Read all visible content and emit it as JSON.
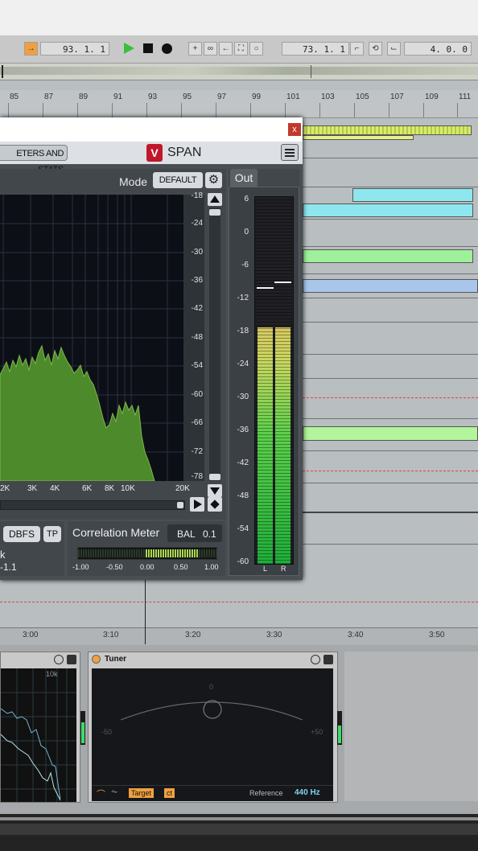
{
  "transport": {
    "position": "93. 1. 1",
    "loop_start": "73. 1. 1",
    "loop_length": "4. 0. 0"
  },
  "ruler": {
    "bars": [
      "85",
      "87",
      "89",
      "91",
      "93",
      "95",
      "97",
      "99",
      "101",
      "103",
      "105",
      "107",
      "109",
      "111"
    ]
  },
  "timeline": {
    "labels": [
      "3:00",
      "3:10",
      "3:20",
      "3:30",
      "3:40",
      "3:50"
    ]
  },
  "span": {
    "close_label": "x",
    "meters_tab": "ETERS AND STATS",
    "logo": "V",
    "title": "SPAN",
    "mode_label": "Mode",
    "mode_value": "DEFAULT",
    "db_scale": [
      "-18",
      "-24",
      "-30",
      "-36",
      "-42",
      "-48",
      "-54",
      "-60",
      "-66",
      "-72",
      "-78"
    ],
    "freq_labels": [
      "2K",
      "3K",
      "4K",
      "6K",
      "8K",
      "10K",
      "20K"
    ],
    "out_label": "Out",
    "out_scale": [
      "6",
      "0",
      "-6",
      "-12",
      "-18",
      "-24",
      "-30",
      "-36",
      "-42",
      "-48",
      "-54",
      "-60"
    ],
    "channels": [
      "L",
      "R"
    ],
    "left_peak": 0.755,
    "right_peak": 0.77,
    "level_fill": 0.645,
    "dbfs_label": "DBFS",
    "tp_label": "TP",
    "stat_label": "k",
    "stat_value": "-1.1",
    "corr_label": "Correlation Meter",
    "bal_label": "BAL",
    "bal_value": "0.1",
    "corr_scale": [
      "-1.00",
      "-0.50",
      "0.00",
      "0.50",
      "1.00"
    ]
  },
  "dev1": {
    "freq_label": "10k"
  },
  "tuner": {
    "title": "Tuner",
    "center": "0",
    "left_mark": "-50",
    "right_mark": "+50",
    "target_label": "Target",
    "ct_label": "ct",
    "reference_label": "Reference",
    "reference_value": "440 Hz"
  },
  "colors": {
    "accent_orange": "#f0a040",
    "clip_cyan": "#8ee7ee",
    "clip_green": "#9ef09a",
    "clip_blue": "#a9c6ea",
    "spectrum_green": "#4c8a2c"
  }
}
